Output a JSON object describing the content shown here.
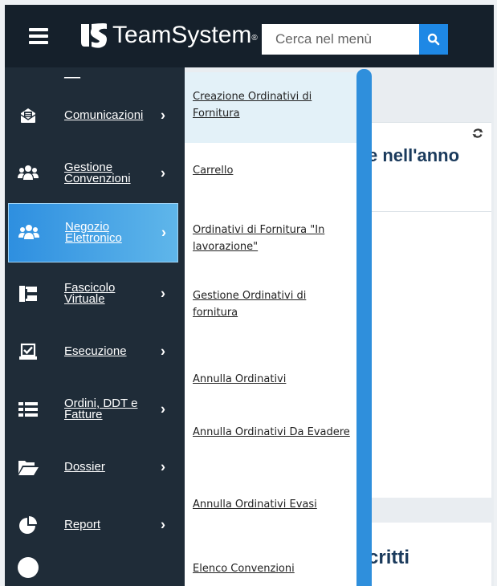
{
  "header": {
    "brand": "TeamSystem",
    "brand_mark": "®",
    "search_placeholder": "Cerca nel menù"
  },
  "sidebar": {
    "truncated_top_label": "___",
    "items": [
      {
        "label": "Comunicazioni",
        "icon": "envelope-icon"
      },
      {
        "label": "Gestione Convenzioni",
        "icon": "users-icon"
      },
      {
        "label": "Negozio Elettronico",
        "icon": "users-icon",
        "active": true
      },
      {
        "label": "Fascicolo Virtuale",
        "icon": "tree-folder-icon"
      },
      {
        "label": "Esecuzione",
        "icon": "checkbox-icon"
      },
      {
        "label": "Ordini, DDT e Fatture",
        "icon": "list-icon"
      },
      {
        "label": "Dossier",
        "icon": "folder-open-icon"
      },
      {
        "label": "Report",
        "icon": "pie-chart-icon"
      }
    ]
  },
  "submenu": {
    "items": [
      {
        "label": "Creazione Ordinativi di Fornitura",
        "highlighted": true
      },
      {
        "label": "Carrello"
      },
      {
        "label": "Ordinativi di Fornitura \"In lavorazione\""
      },
      {
        "label": "Gestione Ordinativi di fornitura"
      },
      {
        "label": "Annulla Ordinativi"
      },
      {
        "label": "Annulla Ordinativi Da Evadere"
      },
      {
        "label": "Annulla Ordinativi Evasi"
      },
      {
        "label": "Elenco Convenzioni"
      }
    ]
  },
  "cards": {
    "card1_title": "e nell'anno",
    "card2_title": "critti"
  },
  "colors": {
    "topbar": "#15202b",
    "sidebar": "#1f2c38",
    "accent": "#1e88e5",
    "submenu_highlight": "#e3f1f8"
  }
}
